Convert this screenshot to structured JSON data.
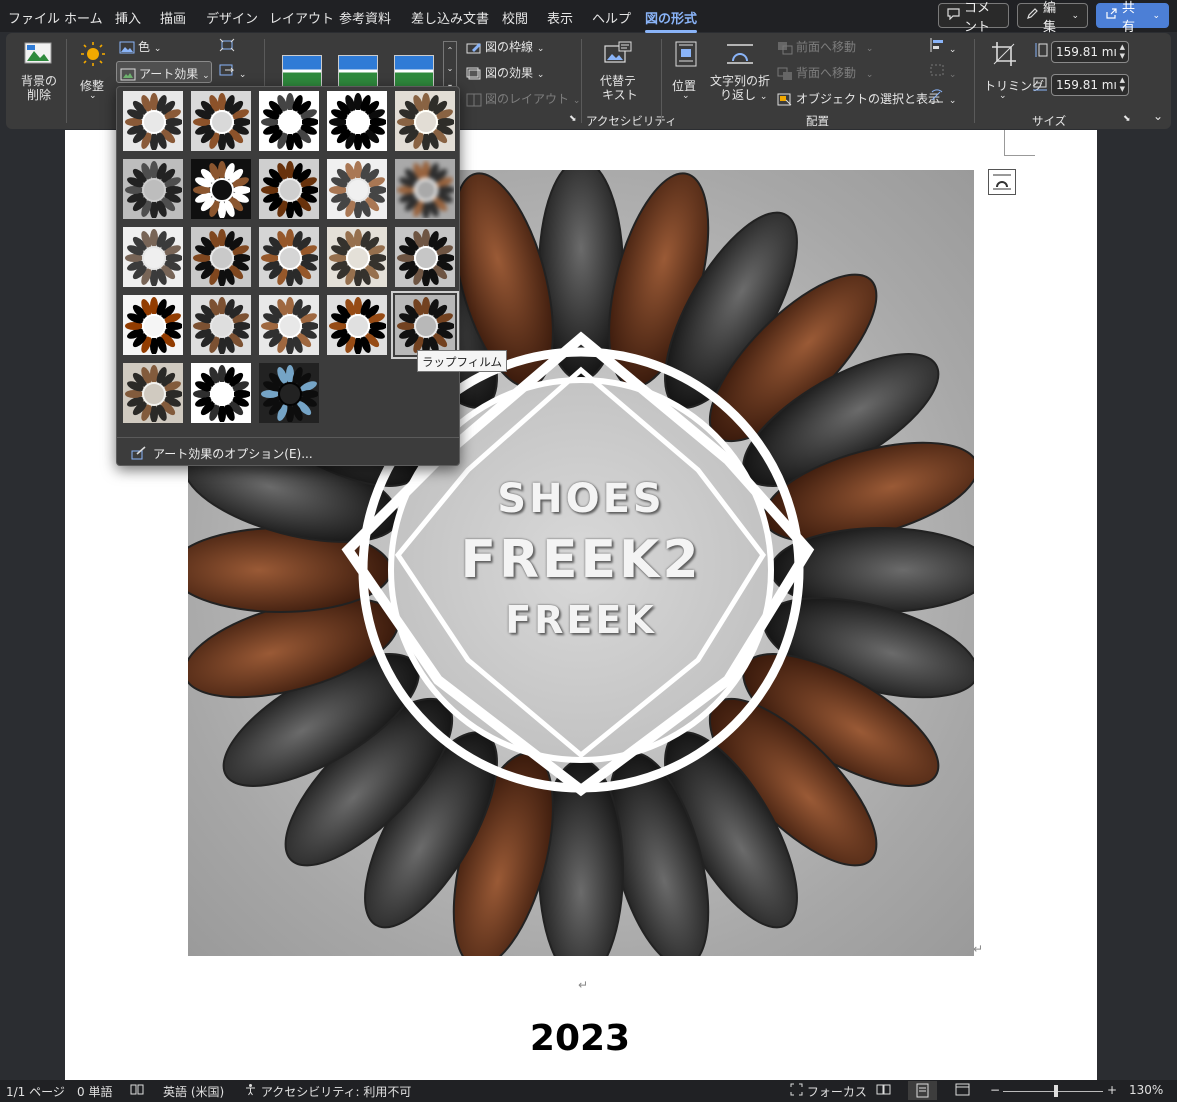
{
  "menu": {
    "tabs": [
      "ファイル",
      "ホーム",
      "挿入",
      "描画",
      "デザイン",
      "レイアウト",
      "参考資料",
      "差し込み文書",
      "校閲",
      "表示",
      "ヘルプ",
      "図の形式"
    ],
    "active_tab": "図の形式",
    "comment_label": "コメント",
    "edit_label": "編集",
    "share_label": "共有"
  },
  "ribbon": {
    "remove_bg": [
      "背景の",
      "削除"
    ],
    "corrections": "修整",
    "color": "色",
    "art_effects": "アート効果",
    "picture_border": "図の枠線",
    "picture_effects": "図の効果",
    "picture_layout": "図のレイアウト",
    "alt_text": [
      "代替テ",
      "キスト"
    ],
    "accessibility_group": "アクセシビリティ",
    "position": "位置",
    "wrap_text": [
      "文字列の折",
      "り返し"
    ],
    "bring_forward": "前面へ移動",
    "send_backward": "背面へ移動",
    "selection_pane": "オブジェクトの選択と表示",
    "arrange_group": "配置",
    "crop": "トリミング",
    "height": "159.81 mı",
    "width": "159.81 mı",
    "size_group": "サイズ"
  },
  "art_menu": {
    "tooltip": "ラップフィルム",
    "options_label": "アート効果のオプション(E)...",
    "selected_index": 19
  },
  "document": {
    "logo_line1": "SHOES",
    "logo_line2": "FREEK2",
    "logo_line3": "FREEK",
    "year": "2023",
    "para_mark": "↵"
  },
  "status": {
    "page": "1/1 ページ",
    "words": "0 単語",
    "language": "英語 (米国)",
    "accessibility": "アクセシビリティ: 利用不可",
    "focus": "フォーカス",
    "zoom": "130%",
    "zoom_minus": "−",
    "zoom_plus": "+"
  },
  "colors": {
    "accent": "#8ab4f8",
    "share": "#4c7fd6",
    "ribbon_bg": "#3b3b3b",
    "menubar_bg": "#202124"
  }
}
